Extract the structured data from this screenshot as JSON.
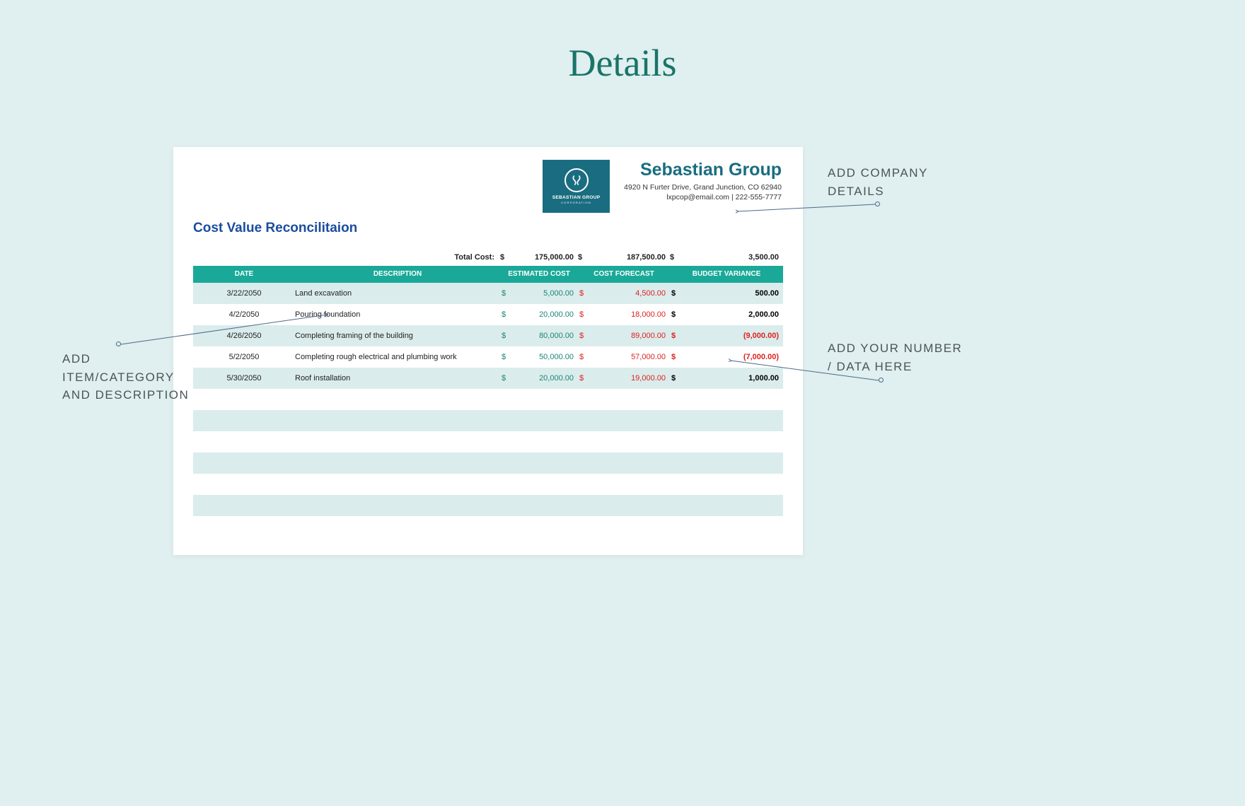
{
  "page_heading": "Details",
  "company": {
    "name": "Sebastian Group",
    "address": "4920 N Furter Drive, Grand Junction, CO 62940",
    "email": "lxpcop@email.com",
    "phone": "222-555-7777",
    "logo_line1": "SEBASTIAN GROUP",
    "logo_line2": "CORPORATION"
  },
  "report_title": "Cost Value Reconcilitaion",
  "totals": {
    "label": "Total Cost:",
    "estimated": "175,000.00",
    "forecast": "187,500.00",
    "variance": "3,500.00"
  },
  "columns": {
    "c1": "DATE",
    "c2": "DESCRIPTION",
    "c3": "ESTIMATED COST",
    "c4": "COST FORECAST",
    "c5": "BUDGET VARIANCE"
  },
  "rows": [
    {
      "date": "3/22/2050",
      "desc": "Land excavation",
      "est": "5,000.00",
      "fore": "4,500.00",
      "var": "500.00",
      "neg": false
    },
    {
      "date": "4/2/2050",
      "desc": "Pouring foundation",
      "est": "20,000.00",
      "fore": "18,000.00",
      "var": "2,000.00",
      "neg": false
    },
    {
      "date": "4/26/2050",
      "desc": "Completing framing of the building",
      "est": "80,000.00",
      "fore": "89,000.00",
      "var": "(9,000.00)",
      "neg": true
    },
    {
      "date": "5/2/2050",
      "desc": "Completing rough electrical and plumbing work",
      "est": "50,000.00",
      "fore": "57,000.00",
      "var": "(7,000.00)",
      "neg": true
    },
    {
      "date": "5/30/2050",
      "desc": "Roof installation",
      "est": "20,000.00",
      "fore": "19,000.00",
      "var": "1,000.00",
      "neg": false
    }
  ],
  "callouts": {
    "company": "ADD COMPANY\nDETAILS",
    "item": "ADD\nITEM/CATEGORY\nAND DESCRIPTION",
    "data": "ADD YOUR NUMBER\n/ DATA HERE"
  }
}
